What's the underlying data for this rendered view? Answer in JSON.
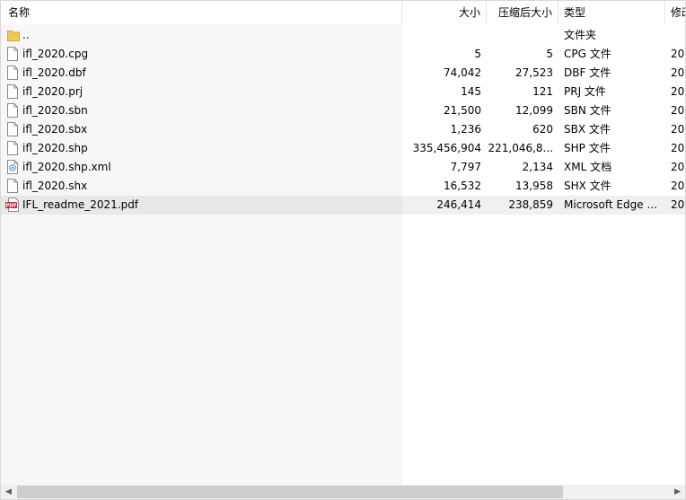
{
  "columns": {
    "name": "名称",
    "size": "大小",
    "compressed": "压缩后大小",
    "type": "类型",
    "modified": "修改"
  },
  "rows": [
    {
      "name": "..",
      "size": "",
      "compressed": "",
      "type": "文件夹",
      "modified": "",
      "icon": "folder-icon"
    },
    {
      "name": "ifl_2020.cpg",
      "size": "5",
      "compressed": "5",
      "type": "CPG 文件",
      "modified": "20",
      "icon": "file-icon"
    },
    {
      "name": "ifl_2020.dbf",
      "size": "74,042",
      "compressed": "27,523",
      "type": "DBF 文件",
      "modified": "20",
      "icon": "file-icon"
    },
    {
      "name": "ifl_2020.prj",
      "size": "145",
      "compressed": "121",
      "type": "PRJ 文件",
      "modified": "20",
      "icon": "file-icon"
    },
    {
      "name": "ifl_2020.sbn",
      "size": "21,500",
      "compressed": "12,099",
      "type": "SBN 文件",
      "modified": "20",
      "icon": "file-icon"
    },
    {
      "name": "ifl_2020.sbx",
      "size": "1,236",
      "compressed": "620",
      "type": "SBX 文件",
      "modified": "20",
      "icon": "file-icon"
    },
    {
      "name": "ifl_2020.shp",
      "size": "335,456,904",
      "compressed": "221,046,8...",
      "type": "SHP 文件",
      "modified": "20",
      "icon": "file-icon"
    },
    {
      "name": "ifl_2020.shp.xml",
      "size": "7,797",
      "compressed": "2,134",
      "type": "XML 文档",
      "modified": "20",
      "icon": "xml-file-icon"
    },
    {
      "name": "ifl_2020.shx",
      "size": "16,532",
      "compressed": "13,958",
      "type": "SHX 文件",
      "modified": "20",
      "icon": "file-icon"
    },
    {
      "name": "IFL_readme_2021.pdf",
      "size": "246,414",
      "compressed": "238,859",
      "type": "Microsoft Edge ...",
      "modified": "20",
      "icon": "pdf-file-icon"
    }
  ],
  "icons": {
    "pdf_label": "PDF"
  },
  "colors": {
    "folder": "#f5c94c",
    "pdf": "#c3304c"
  }
}
